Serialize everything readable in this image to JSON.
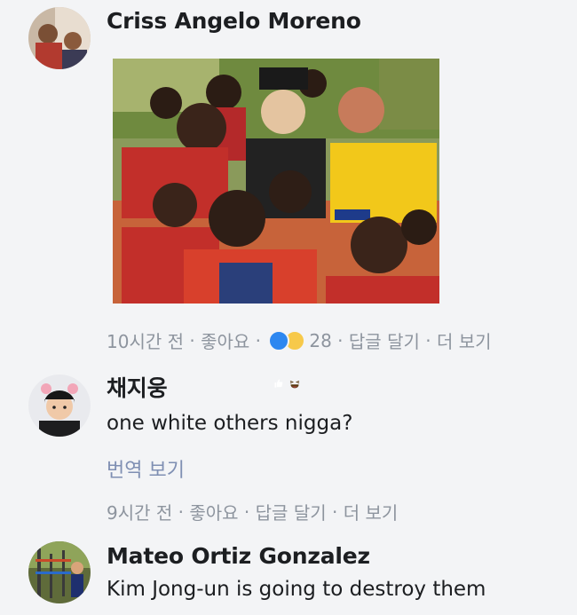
{
  "comments": [
    {
      "author": "Criss Angelo Moreno",
      "meta": {
        "time": "10시간 전",
        "sep": " · ",
        "like": "좋아요",
        "reaction_count": "28",
        "reply": "답글 달기",
        "more": "더 보기"
      }
    },
    {
      "author": "채지웅",
      "text": "one white others nigga?",
      "translate": "번역 보기",
      "meta": {
        "time": "9시간 전",
        "sep": " · ",
        "like": "좋아요",
        "reply": "답글 달기",
        "more": "더 보기"
      }
    },
    {
      "author": "Mateo Ortiz Gonzalez",
      "text": "Kim Jong-un is going to destroy them"
    }
  ],
  "icons": {
    "like": "thumbs-up-icon",
    "haha": "laughing-face-icon"
  },
  "colors": {
    "background": "#f3f4f6",
    "meta": "#8d949e",
    "translate_link": "#7f8fb3",
    "like_blue": "#2d87f0",
    "haha_yellow": "#f7c94a"
  }
}
